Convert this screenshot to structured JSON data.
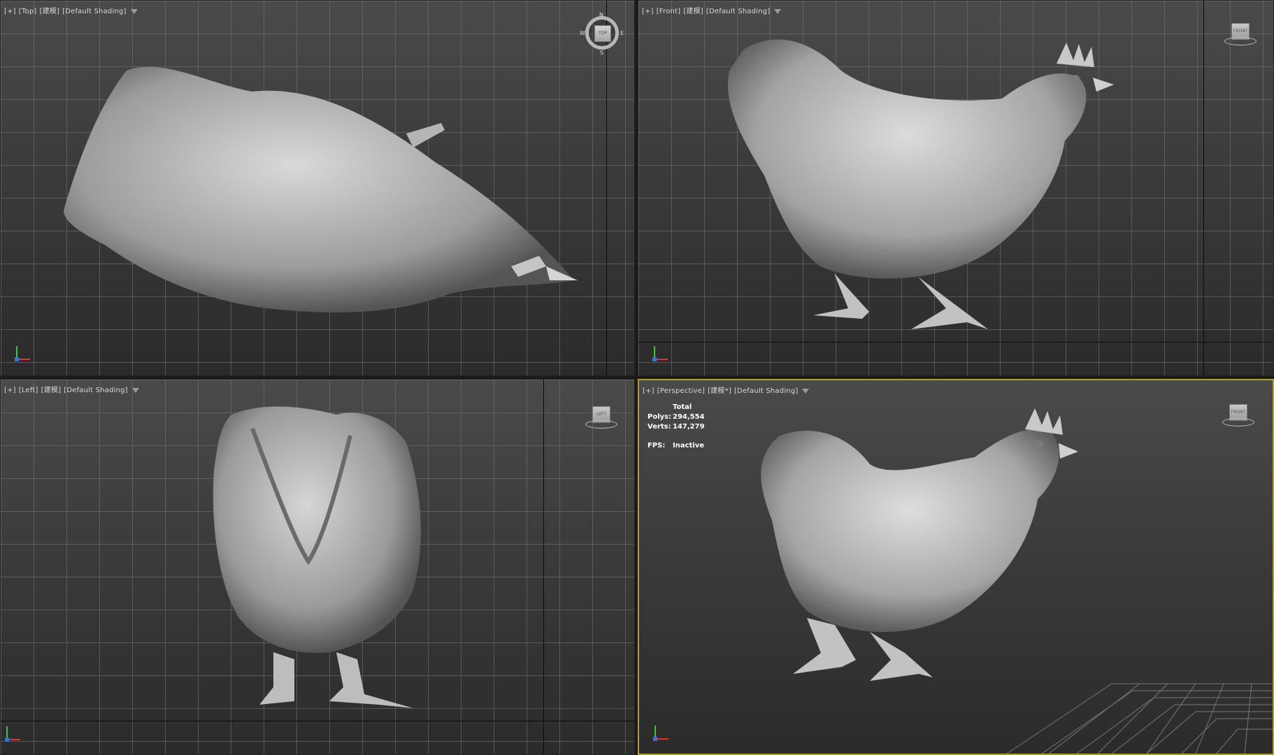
{
  "viewports": {
    "top": {
      "label_plus": "[+]",
      "label_view": "[Top]",
      "label_mode": "[建模]",
      "label_shading": "[Default Shading]",
      "compass": {
        "n": "N",
        "s": "S",
        "e": "E",
        "w": "W",
        "cube": "TOP"
      }
    },
    "front": {
      "label_plus": "[+]",
      "label_view": "[Front]",
      "label_mode": "[建模]",
      "label_shading": "[Default Shading]",
      "viewcube": "FRONT"
    },
    "left": {
      "label_plus": "[+]",
      "label_view": "[Left]",
      "label_mode": "[建模]",
      "label_shading": "[Default Shading]",
      "viewcube": "LEFT"
    },
    "perspective": {
      "label_plus": "[+]",
      "label_view": "[Perspective]",
      "label_mode": "[建模*]",
      "label_shading": "[Default Shading]",
      "viewcube": "FRONT",
      "stats": {
        "header": "Total",
        "polys_label": "Polys:",
        "polys_value": "294,554",
        "verts_label": "Verts:",
        "verts_value": "147,279",
        "fps_label": "FPS:",
        "fps_value": "Inactive"
      }
    }
  },
  "colors": {
    "active_border": "#b59a3a",
    "model": "#bdbdbd"
  }
}
